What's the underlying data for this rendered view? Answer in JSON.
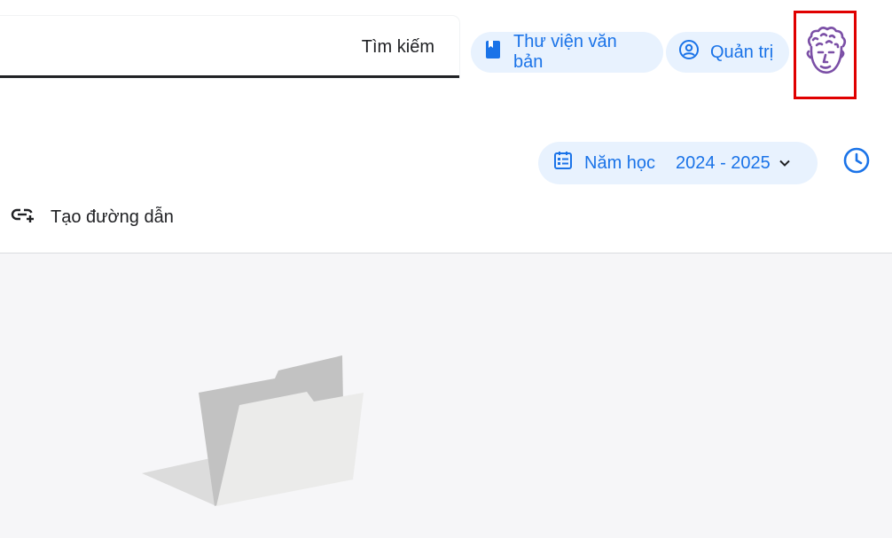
{
  "header": {
    "search_label": "Tìm kiếm",
    "library_label": "Thư viện văn bản",
    "admin_label": "Quản trị"
  },
  "toolbar": {
    "year_label": "Năm học",
    "year_value": "2024 - 2025",
    "create_link_label": "Tạo đường dẫn"
  },
  "colors": {
    "accent": "#1a73e8",
    "pill_bg": "#e8f2fe",
    "highlight_border": "#e00000",
    "avatar": "#7b4fa6",
    "content_bg": "#f6f6f8"
  },
  "icons": {
    "library": "book-icon",
    "admin": "user-circle-icon",
    "year": "calendar-icon",
    "history": "clock-icon",
    "create": "link-add-icon",
    "empty": "empty-folder-illustration"
  }
}
